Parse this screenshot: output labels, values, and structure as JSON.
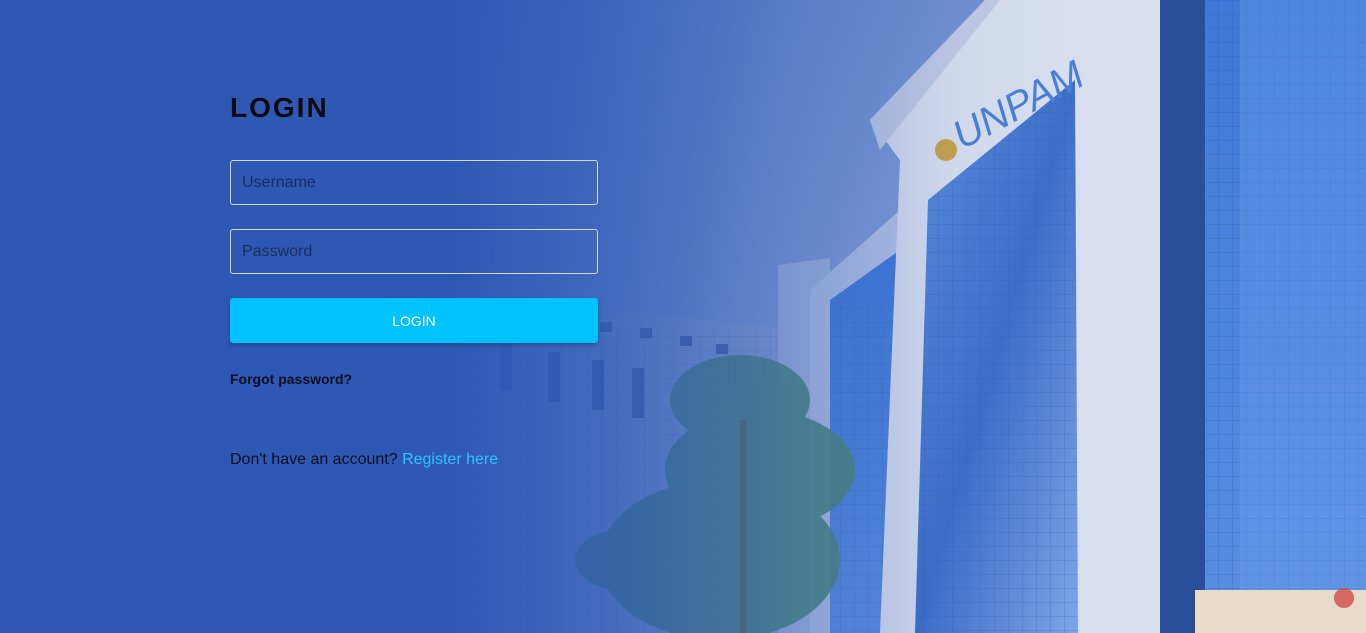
{
  "login": {
    "title": "LOGIN",
    "username_placeholder": "Username",
    "password_placeholder": "Password",
    "button_label": "LOGIN",
    "forgot_password": "Forgot password?",
    "register_prompt": "Don't have an account?",
    "register_link": "Register here"
  },
  "background": {
    "building_sign": "UNPAM"
  },
  "colors": {
    "page_blue": "#2f58b4",
    "button": "#00c2ff",
    "link": "#2fc4ff"
  }
}
